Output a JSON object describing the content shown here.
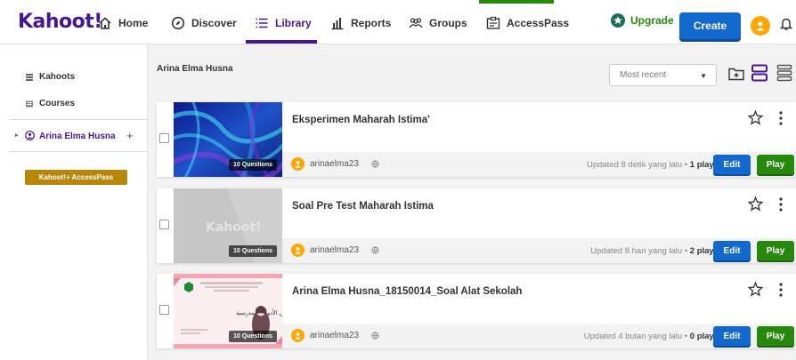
{
  "app": {
    "logo": "Kahoot!"
  },
  "nav": {
    "items": [
      {
        "label": "Home",
        "icon": "home-icon"
      },
      {
        "label": "Discover",
        "icon": "compass-icon"
      },
      {
        "label": "Library",
        "icon": "list-icon"
      },
      {
        "label": "Reports",
        "icon": "bar-chart-icon"
      },
      {
        "label": "Groups",
        "icon": "people-icon"
      },
      {
        "label": "AccessPass",
        "icon": "pass-icon"
      }
    ],
    "active": "Library",
    "upgrade_label": "Upgrade",
    "create_label": "Create"
  },
  "sidebar": {
    "items": [
      {
        "label": "Kahoots",
        "icon": "list-icon"
      },
      {
        "label": "Courses",
        "icon": "course-icon"
      }
    ],
    "user": {
      "label": "Arina Elma Husna",
      "add": "+"
    },
    "accesspass_label": "Kahoot!+ AccessPass"
  },
  "main": {
    "breadcrumb": "Arina Elma Husna",
    "sort": {
      "selected": "Most recent"
    },
    "cards": [
      {
        "title": "Eksperimen Maharah Istima'",
        "questions": "10 Questions",
        "owner": "arinaelma23",
        "updated": "Updated 8 detik yang lalu",
        "plays": "1 plays",
        "edit": "Edit",
        "play": "Play"
      },
      {
        "title": "Soal Pre Test Maharah Istima",
        "questions": "10 Questions",
        "owner": "arinaelma23",
        "updated": "Updated 8 hari yang lalu",
        "plays": "2 plays",
        "edit": "Edit",
        "play": "Play",
        "thumb_watermark": "Kahoot!"
      },
      {
        "title": "Arina Elma Husna_18150014_Soal Alat Sekolah",
        "questions": "10 Questions",
        "owner": "arinaelma23",
        "updated": "Updated 4 bulan yang lalu",
        "plays": "0 plays",
        "edit": "Edit",
        "play": "Play",
        "thumb_text": "مفردات عن الأدوات المدرسية"
      }
    ]
  },
  "colors": {
    "brand": "#46178f",
    "primary": "#1368ce",
    "success": "#26890c",
    "accent_gold": "#b8860b",
    "avatar": "#ffa602"
  }
}
